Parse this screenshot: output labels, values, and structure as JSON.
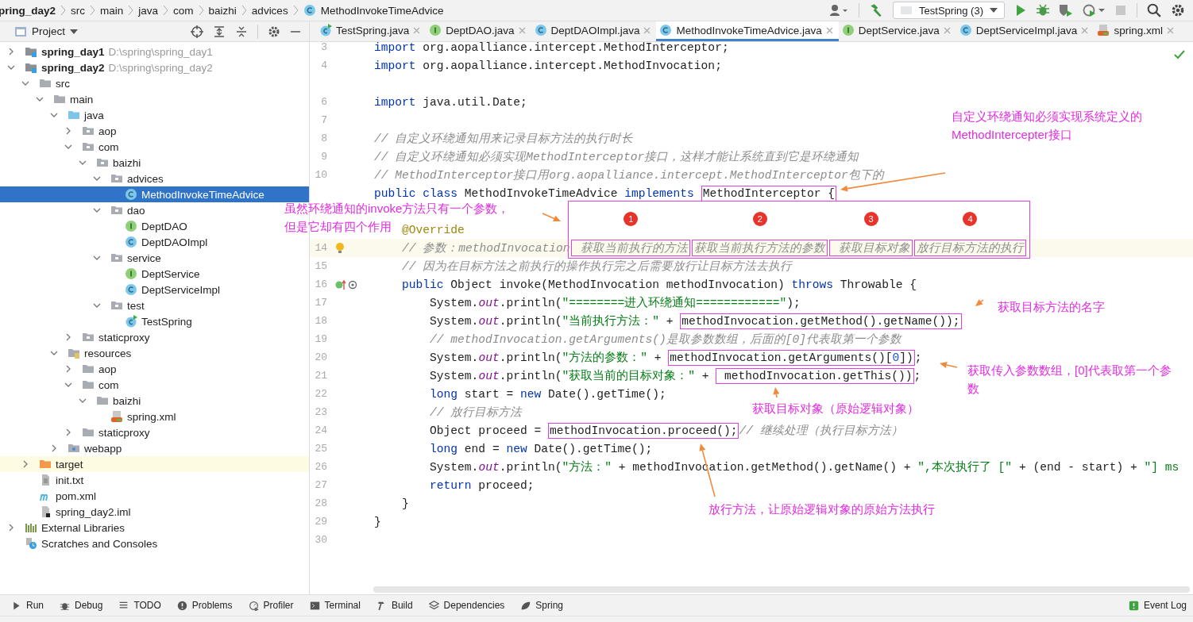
{
  "breadcrumbs": [
    {
      "label": "pring_day2"
    },
    {
      "label": "src"
    },
    {
      "label": "main"
    },
    {
      "label": "java"
    },
    {
      "label": "com"
    },
    {
      "label": "baizhi"
    },
    {
      "label": "advices"
    },
    {
      "label": "MethodInvokeTimeAdvice"
    }
  ],
  "toolbar": {
    "run_configuration": "TestSpring (3)"
  },
  "project_panel": {
    "title": "Project",
    "tree": [
      {
        "label": "spring_day1",
        "path": "D:\\spring\\spring_day1",
        "kind": "module",
        "expanded": false,
        "selected": false,
        "highlighted": false
      },
      {
        "label": "spring_day2",
        "path": "D:\\spring\\spring_day2",
        "kind": "module",
        "expanded": true,
        "selected": false,
        "highlighted": false,
        "children": [
          {
            "label": "src",
            "kind": "folder",
            "expanded": true,
            "selected": false,
            "highlighted": false,
            "children": [
              {
                "label": "main",
                "kind": "folder",
                "expanded": true,
                "selected": false,
                "highlighted": false,
                "children": [
                  {
                    "label": "java",
                    "kind": "source",
                    "expanded": true,
                    "selected": false,
                    "highlighted": false,
                    "children": [
                      {
                        "label": "aop",
                        "kind": "package",
                        "expanded": false,
                        "selected": false,
                        "highlighted": false
                      },
                      {
                        "label": "com",
                        "kind": "package",
                        "expanded": true,
                        "selected": false,
                        "highlighted": false,
                        "children": [
                          {
                            "label": "baizhi",
                            "kind": "package",
                            "expanded": true,
                            "selected": false,
                            "highlighted": false,
                            "children": [
                              {
                                "label": "advices",
                                "kind": "package",
                                "expanded": true,
                                "selected": false,
                                "highlighted": false,
                                "children": [
                                  {
                                    "label": "MethodInvokeTimeAdvice",
                                    "kind": "class",
                                    "selected": true,
                                    "highlighted": false
                                  }
                                ]
                              },
                              {
                                "label": "dao",
                                "kind": "package",
                                "expanded": true,
                                "selected": false,
                                "highlighted": false,
                                "children": [
                                  {
                                    "label": "DeptDAO",
                                    "kind": "interface",
                                    "selected": false,
                                    "highlighted": false
                                  },
                                  {
                                    "label": "DeptDAOImpl",
                                    "kind": "class",
                                    "selected": false,
                                    "highlighted": false
                                  }
                                ]
                              },
                              {
                                "label": "service",
                                "kind": "package",
                                "expanded": true,
                                "selected": false,
                                "highlighted": false,
                                "children": [
                                  {
                                    "label": "DeptService",
                                    "kind": "interface",
                                    "selected": false,
                                    "highlighted": false
                                  },
                                  {
                                    "label": "DeptServiceImpl",
                                    "kind": "class",
                                    "selected": false,
                                    "highlighted": false
                                  }
                                ]
                              },
                              {
                                "label": "test",
                                "kind": "package",
                                "expanded": true,
                                "selected": false,
                                "highlighted": false,
                                "children": [
                                  {
                                    "label": "TestSpring",
                                    "kind": "test",
                                    "selected": false,
                                    "highlighted": false
                                  }
                                ]
                              }
                            ]
                          }
                        ]
                      },
                      {
                        "label": "staticproxy",
                        "kind": "package",
                        "expanded": false,
                        "selected": false,
                        "highlighted": false
                      }
                    ]
                  },
                  {
                    "label": "resources",
                    "kind": "resources",
                    "expanded": true,
                    "selected": false,
                    "highlighted": false,
                    "children": [
                      {
                        "label": "aop",
                        "kind": "folder",
                        "expanded": false,
                        "selected": false,
                        "highlighted": false
                      },
                      {
                        "label": "com",
                        "kind": "folder",
                        "expanded": true,
                        "selected": false,
                        "highlighted": false,
                        "children": [
                          {
                            "label": "baizhi",
                            "kind": "folder",
                            "expanded": true,
                            "selected": false,
                            "highlighted": false,
                            "children": [
                              {
                                "label": "spring.xml",
                                "kind": "xml",
                                "selected": false,
                                "highlighted": false
                              }
                            ]
                          }
                        ]
                      },
                      {
                        "label": "staticproxy",
                        "kind": "folder",
                        "expanded": false,
                        "selected": false,
                        "highlighted": false
                      }
                    ]
                  },
                  {
                    "label": "webapp",
                    "kind": "web",
                    "expanded": false,
                    "selected": false,
                    "highlighted": false
                  }
                ]
              }
            ]
          },
          {
            "label": "target",
            "kind": "excluded",
            "expanded": false,
            "selected": false,
            "highlighted": true
          },
          {
            "label": "init.txt",
            "kind": "text",
            "selected": false,
            "highlighted": false
          },
          {
            "label": "pom.xml",
            "kind": "maven",
            "selected": false,
            "highlighted": false
          },
          {
            "label": "spring_day2.iml",
            "kind": "iml",
            "selected": false,
            "highlighted": false
          }
        ]
      },
      {
        "label": "External Libraries",
        "kind": "libraries",
        "expanded": false,
        "selected": false,
        "highlighted": false
      },
      {
        "label": "Scratches and Consoles",
        "kind": "scratches",
        "selected": false,
        "highlighted": false
      }
    ]
  },
  "editor": {
    "tabs": [
      {
        "label": "TestSpring.java",
        "kind": "test",
        "selected": false
      },
      {
        "label": "DeptDAO.java",
        "kind": "interface",
        "selected": false
      },
      {
        "label": "DeptDAOImpl.java",
        "kind": "class",
        "selected": false
      },
      {
        "label": "MethodInvokeTimeAdvice.java",
        "kind": "class",
        "selected": true
      },
      {
        "label": "DeptService.java",
        "kind": "interface",
        "selected": false
      },
      {
        "label": "DeptServiceImpl.java",
        "kind": "class",
        "selected": false
      },
      {
        "label": "spring.xml",
        "kind": "xml",
        "selected": false
      }
    ],
    "lines": [
      {
        "no": "3",
        "kind": "code",
        "current": false,
        "segs": [
          {
            "kind": "keyword",
            "text": "import"
          },
          {
            "kind": "plain",
            "text": " org.aopalliance.intercept.MethodInterceptor;"
          }
        ]
      },
      {
        "no": "4",
        "kind": "code",
        "current": false,
        "segs": [
          {
            "kind": "keyword",
            "text": "import"
          },
          {
            "kind": "plain",
            "text": " org.aopalliance.intercept.MethodInvocation;"
          }
        ]
      },
      {
        "kind": "code",
        "current": false
      },
      {
        "no": "6",
        "kind": "code",
        "current": false,
        "segs": [
          {
            "kind": "keyword",
            "text": "import"
          },
          {
            "kind": "plain",
            "text": " java.util.Date;"
          }
        ]
      },
      {
        "no": "7",
        "kind": "code",
        "current": false
      },
      {
        "no": "8",
        "kind": "code",
        "current": false,
        "segs": [
          {
            "kind": "comment",
            "text": "// 自定义环绕通知用来记录目标方法的执行时长"
          }
        ]
      },
      {
        "no": "9",
        "kind": "code",
        "current": false,
        "segs": [
          {
            "kind": "comment",
            "text": "// 自定义环绕通知必须实现MethodInterceptor接口，这样才能让系统直到它是环绕通知"
          }
        ]
      },
      {
        "no": "10",
        "kind": "code",
        "current": false,
        "segs": [
          {
            "kind": "comment",
            "text": "// MethodInterceptor接口用org.aopalliance.intercept.MethodInterceptor包下的"
          }
        ]
      },
      {
        "kind": "code",
        "current": false,
        "segs": [
          {
            "kind": "keyword",
            "text": "public class"
          },
          {
            "kind": "plain",
            "text": " MethodInvokeTimeAdvice "
          },
          {
            "kind": "keyword",
            "text": "implements "
          },
          {
            "kind": "box",
            "parts": [
              {
                "kind": "plain",
                "text": "MethodInterceptor {"
              }
            ]
          }
        ]
      },
      {
        "kind": "code",
        "current": false
      },
      {
        "kind": "code",
        "current": false,
        "segs": [
          {
            "kind": "annotation",
            "text": "    @Override"
          }
        ]
      },
      {
        "no": "14",
        "kind": "bulb",
        "current": true,
        "segs": [
          {
            "kind": "comment",
            "text": "    // 参数：methodInvocation"
          },
          {
            "kind": "callouts",
            "items": [
              {
                "badge": "1",
                "text": " 获取当前执行的方法"
              },
              {
                "badge": "2",
                "text": "获取当前执行方法的参数"
              },
              {
                "badge": "3",
                "text": " 获取目标对象"
              },
              {
                "badge": "4",
                "text": "放行目标方法的执行"
              }
            ]
          }
        ]
      },
      {
        "no": "15",
        "kind": "code",
        "current": false,
        "segs": [
          {
            "kind": "comment",
            "text": "    // 因为在目标方法之前执行的操作执行完之后需要放行让目标方法去执行"
          }
        ]
      },
      {
        "no": "16",
        "kind": "override",
        "current": false,
        "segs": [
          {
            "kind": "keyword",
            "text": "    public"
          },
          {
            "kind": "plain",
            "text": " Object invoke(MethodInvocation methodInvocation) "
          },
          {
            "kind": "keyword",
            "text": "throws"
          },
          {
            "kind": "plain",
            "text": " Throwable {"
          }
        ]
      },
      {
        "no": "17",
        "kind": "code",
        "current": false,
        "segs": [
          {
            "kind": "plain",
            "text": "        System."
          },
          {
            "kind": "field",
            "text": "out"
          },
          {
            "kind": "plain",
            "text": ".println("
          },
          {
            "kind": "string",
            "text": "\"========进入环绕通知============\""
          },
          {
            "kind": "plain",
            "text": ");"
          }
        ]
      },
      {
        "no": "18",
        "kind": "code",
        "current": false,
        "segs": [
          {
            "kind": "plain",
            "text": "        System."
          },
          {
            "kind": "field",
            "text": "out"
          },
          {
            "kind": "plain",
            "text": ".println("
          },
          {
            "kind": "string",
            "text": "\"当前执行方法：\""
          },
          {
            "kind": "plain",
            "text": " + "
          },
          {
            "kind": "box",
            "parts": [
              {
                "kind": "plain",
                "text": "methodInvocation.getMethod().getName());"
              }
            ]
          }
        ]
      },
      {
        "no": "19",
        "kind": "code",
        "current": false,
        "segs": [
          {
            "kind": "comment",
            "text": "        // methodInvocation.getArguments()是取参数数组，后面的[0]代表取第一个参数"
          }
        ]
      },
      {
        "no": "20",
        "kind": "code",
        "current": false,
        "segs": [
          {
            "kind": "plain",
            "text": "        System."
          },
          {
            "kind": "field",
            "text": "out"
          },
          {
            "kind": "plain",
            "text": ".println("
          },
          {
            "kind": "string",
            "text": "\"方法的参数：\""
          },
          {
            "kind": "plain",
            "text": " + "
          },
          {
            "kind": "box",
            "parts": [
              {
                "kind": "plain",
                "text": "methodInvocation.getArguments()["
              },
              {
                "kind": "number",
                "text": "0"
              },
              {
                "kind": "plain",
                "text": "])"
              }
            ]
          },
          {
            "kind": "plain",
            "text": ";"
          }
        ]
      },
      {
        "no": "21",
        "kind": "code",
        "current": false,
        "segs": [
          {
            "kind": "plain",
            "text": "        System."
          },
          {
            "kind": "field",
            "text": "out"
          },
          {
            "kind": "plain",
            "text": ".println("
          },
          {
            "kind": "string",
            "text": "\"获取当前的目标对象：\""
          },
          {
            "kind": "plain",
            "text": " + "
          },
          {
            "kind": "box",
            "parts": [
              {
                "kind": "plain",
                "text": " methodInvocation.getThis())"
              }
            ]
          },
          {
            "kind": "plain",
            "text": ";"
          }
        ]
      },
      {
        "no": "22",
        "kind": "code",
        "current": false,
        "segs": [
          {
            "kind": "keyword",
            "text": "        long"
          },
          {
            "kind": "plain",
            "text": " start = "
          },
          {
            "kind": "keyword",
            "text": "new"
          },
          {
            "kind": "plain",
            "text": " Date().getTime();"
          }
        ]
      },
      {
        "no": "23",
        "kind": "code",
        "current": false,
        "segs": [
          {
            "kind": "comment",
            "text": "        // 放行目标方法"
          }
        ]
      },
      {
        "no": "24",
        "kind": "code",
        "current": false,
        "segs": [
          {
            "kind": "plain",
            "text": "        Object proceed = "
          },
          {
            "kind": "box",
            "parts": [
              {
                "kind": "plain",
                "text": "methodInvocation.proceed();"
              }
            ]
          },
          {
            "kind": "comment",
            "text": "// 继续处理（执行目标方法）"
          }
        ]
      },
      {
        "no": "25",
        "kind": "code",
        "current": false,
        "segs": [
          {
            "kind": "keyword",
            "text": "        long"
          },
          {
            "kind": "plain",
            "text": " end = "
          },
          {
            "kind": "keyword",
            "text": "new"
          },
          {
            "kind": "plain",
            "text": " Date().getTime();"
          }
        ]
      },
      {
        "no": "26",
        "kind": "code",
        "current": false,
        "segs": [
          {
            "kind": "plain",
            "text": "        System."
          },
          {
            "kind": "field",
            "text": "out"
          },
          {
            "kind": "plain",
            "text": ".println("
          },
          {
            "kind": "string",
            "text": "\"方法：\""
          },
          {
            "kind": "plain",
            "text": " + methodInvocation.getMethod().getName() + "
          },
          {
            "kind": "string",
            "text": "\",本次执行了 [\""
          },
          {
            "kind": "plain",
            "text": " + (end - start) + "
          },
          {
            "kind": "string",
            "text": "\"] ms"
          }
        ]
      },
      {
        "no": "27",
        "kind": "code",
        "current": false,
        "segs": [
          {
            "kind": "keyword",
            "text": "        return"
          },
          {
            "kind": "plain",
            "text": " proceed;"
          }
        ]
      },
      {
        "no": "28",
        "kind": "code",
        "current": false,
        "segs": [
          {
            "kind": "plain",
            "text": "    }"
          }
        ]
      },
      {
        "no": "29",
        "kind": "code",
        "current": false,
        "segs": [
          {
            "kind": "plain",
            "text": "}"
          }
        ]
      },
      {
        "no": "30",
        "kind": "code",
        "current": false
      }
    ]
  },
  "annotations": [
    {
      "lines": [
        "自定义环绕通知必须实现系统定义的",
        "MethodIntercepter接口"
      ]
    },
    {
      "lines": [
        "虽然环绕通知的invoke方法只有一个参数，",
        "但是它却有四个作用"
      ]
    },
    {
      "lines": [
        "获取目标方法的名字"
      ]
    },
    {
      "lines": [
        "获取传入参数数组，[0]代表取第一个参",
        "数"
      ]
    },
    {
      "lines": [
        "获取目标对象（原始逻辑对象）"
      ]
    },
    {
      "lines": [
        "放行方法，让原始逻辑对象的原始方法执行"
      ]
    }
  ],
  "tool_windows": [
    {
      "label": "Run"
    },
    {
      "label": "Debug"
    },
    {
      "label": "TODO"
    },
    {
      "label": "Problems"
    },
    {
      "label": "Profiler"
    },
    {
      "label": "Terminal"
    },
    {
      "label": "Build"
    },
    {
      "label": "Dependencies"
    },
    {
      "label": "Spring"
    }
  ],
  "event_log": "Event Log"
}
